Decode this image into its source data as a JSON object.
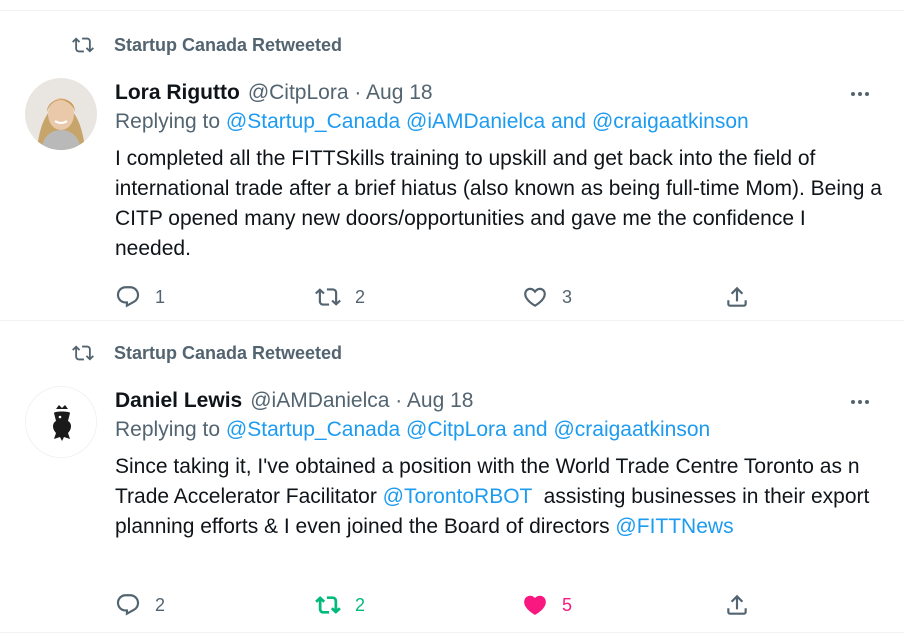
{
  "tweets": [
    {
      "retweeted_by": "Startup Canada Retweeted",
      "name": "Lora Rigutto",
      "handle_date": "@CitpLora · Aug 18",
      "replying_prefix": "Replying to",
      "replying_mentions": [
        "@Startup_Canada",
        "@iAMDanielca"
      ],
      "replying_and": "and",
      "replying_last": "@craigaatkinson",
      "body_text": "I completed all the FITTSkills training to upskill and get back into the field of international trade after a brief hiatus (also known as being full-time Mom). Being a CITP opened many new doors/opportunities and gave me the confidence I needed.",
      "reply_count": "1",
      "retweet_count": "2",
      "like_count": "3",
      "liked": false,
      "retweeted": false
    },
    {
      "retweeted_by": "Startup Canada Retweeted",
      "name": "Daniel Lewis",
      "handle_date": "@iAMDanielca · Aug 18",
      "replying_prefix": "Replying to",
      "replying_mentions": [
        "@Startup_Canada",
        "@CitpLora"
      ],
      "replying_and": "and",
      "replying_last": "@craigaatkinson",
      "body_part1": "Since taking it, I've obtained a position with the World Trade Centre Toronto as n Trade Accelerator Facilitator ",
      "body_mention1": "@TorontoRBOT",
      "body_part2": "  assisting businesses in their export planning efforts & I even joined the Board of directors ",
      "body_mention2": "@FITTNews",
      "reply_count": "2",
      "retweet_count": "2",
      "like_count": "5",
      "liked": true,
      "retweeted": true
    }
  ],
  "colors": {
    "link": "#1d9bf0",
    "secondary": "#536471",
    "retweet_active": "#00ba7c",
    "like_active": "#f91880"
  }
}
